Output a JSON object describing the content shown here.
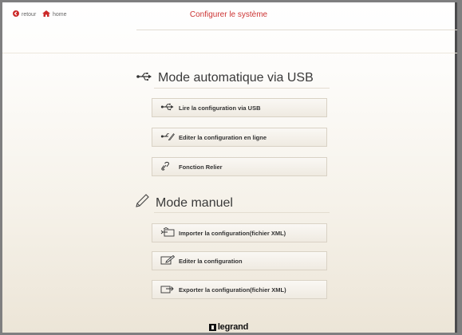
{
  "header": {
    "back_label": "retour",
    "home_label": "home",
    "title": "Configurer le système"
  },
  "usb_section": {
    "title": "Mode automatique via USB",
    "icon": "usb-icon",
    "buttons": [
      {
        "label": "Lire la configuration via USB",
        "icon": "usb-icon"
      },
      {
        "label": "Editer la configuration en ligne",
        "icon": "usb-edit-icon"
      },
      {
        "label": "Fonction Relier",
        "icon": "link-icon"
      }
    ]
  },
  "manual_section": {
    "title": "Mode manuel",
    "icon": "pencil-icon",
    "buttons": [
      {
        "label": "Importer la configuration(fichier XML)",
        "icon": "import-icon"
      },
      {
        "label": "Editer la configuration",
        "icon": "edit-icon"
      },
      {
        "label": "Exporter la configuration(fichier XML)",
        "icon": "export-icon"
      }
    ]
  },
  "brand": {
    "name": "legrand"
  },
  "colors": {
    "title_red": "#cc3333",
    "back_icon_red": "#cc2a2a",
    "frame_border": "#4b4b4d"
  }
}
